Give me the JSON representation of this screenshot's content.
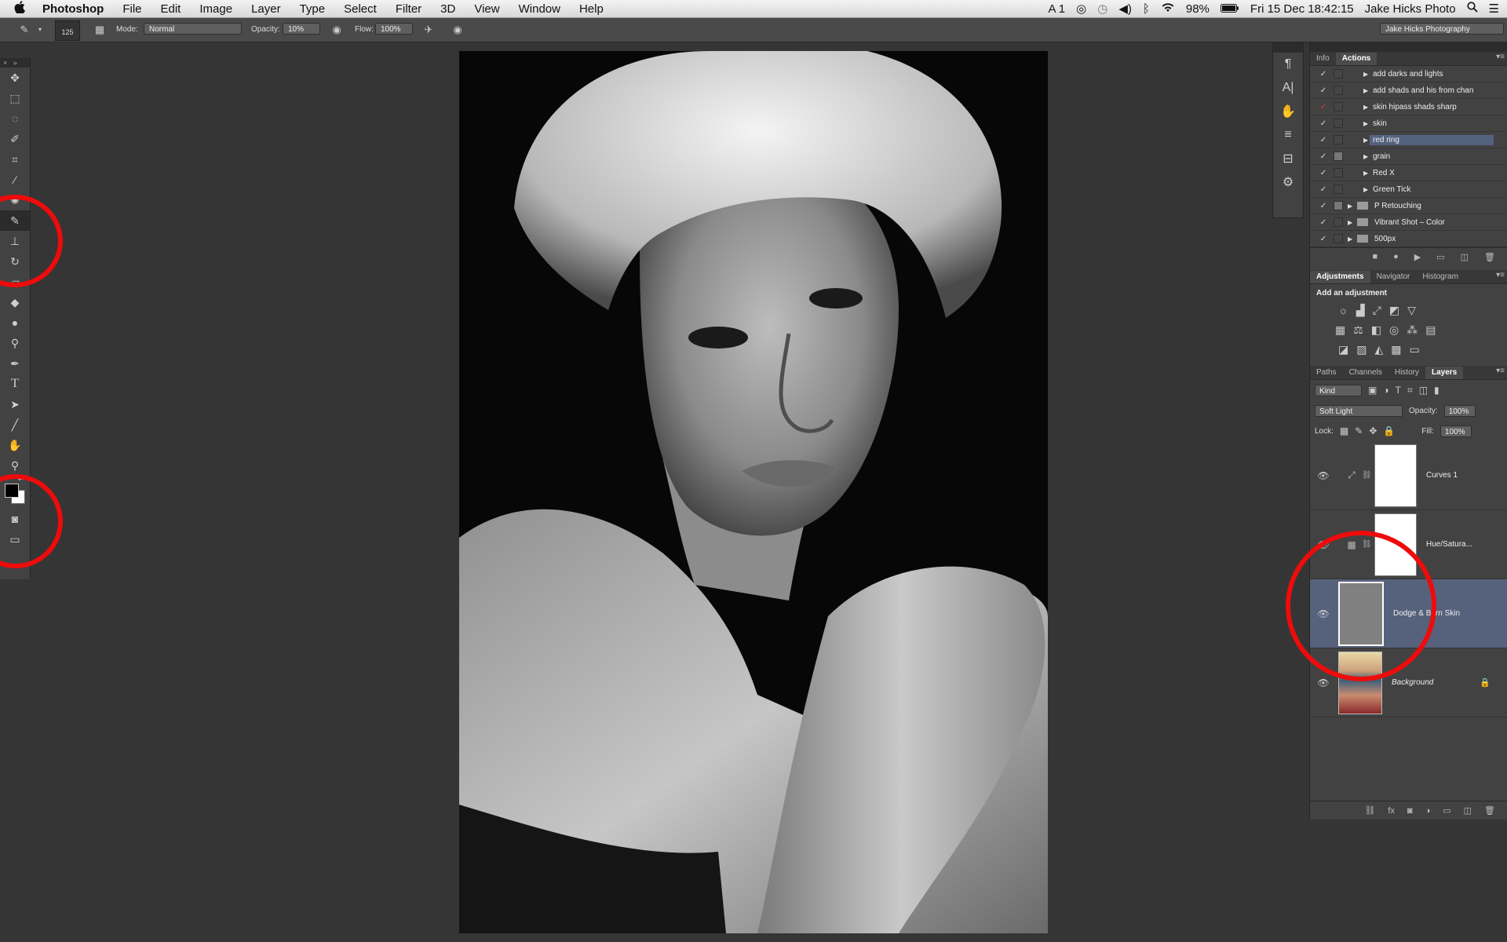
{
  "menubar": {
    "app_name": "Photoshop",
    "items": [
      "File",
      "Edit",
      "Image",
      "Layer",
      "Type",
      "Select",
      "Filter",
      "3D",
      "View",
      "Window",
      "Help"
    ],
    "status": {
      "input": "A 1",
      "battery": "98%",
      "clock": "Fri 15 Dec  18:42:15",
      "user": "Jake Hicks Photo"
    }
  },
  "options_bar": {
    "brush_size": "125",
    "mode_label": "Mode:",
    "mode_value": "Normal",
    "opacity_label": "Opacity:",
    "opacity_value": "10%",
    "flow_label": "Flow:",
    "flow_value": "100%",
    "workspace": "Jake Hicks Photography"
  },
  "actions_panel": {
    "tabs": [
      "Info",
      "Actions"
    ],
    "active_tab": "Actions",
    "rows": [
      {
        "name": "add darks and lights",
        "check": "✓",
        "folder": false,
        "selected": false
      },
      {
        "name": "add shads and his from chan",
        "check": "✓",
        "folder": false,
        "selected": false
      },
      {
        "name": "skin hipass shads sharp",
        "check": "✓",
        "folder": false,
        "selected": false,
        "red_check": true
      },
      {
        "name": "skin",
        "check": "✓",
        "folder": false,
        "selected": false
      },
      {
        "name": "red ring",
        "check": "✓",
        "folder": false,
        "selected": true
      },
      {
        "name": "grain",
        "check": "✓",
        "folder": false,
        "selected": false
      },
      {
        "name": "Red X",
        "check": "✓",
        "folder": false,
        "selected": false
      },
      {
        "name": "Green Tick",
        "check": "✓",
        "folder": false,
        "selected": false
      },
      {
        "name": "P Retouching",
        "check": "✓",
        "folder": true,
        "selected": false
      },
      {
        "name": "Vibrant Shot – Color",
        "check": "✓",
        "folder": true,
        "selected": false
      },
      {
        "name": "500px",
        "check": "✓",
        "folder": true,
        "selected": false
      }
    ]
  },
  "adjustments_panel": {
    "tabs": [
      "Adjustments",
      "Navigator",
      "Histogram"
    ],
    "active_tab": "Adjustments",
    "title": "Add an adjustment"
  },
  "layers_panel": {
    "tabs": [
      "Paths",
      "Channels",
      "History",
      "Layers"
    ],
    "active_tab": "Layers",
    "filter_kind": "Kind",
    "blend_mode": "Soft Light",
    "opacity_label": "Opacity:",
    "opacity_value": "100%",
    "lock_label": "Lock:",
    "fill_label": "Fill:",
    "fill_value": "100%",
    "layers": [
      {
        "name": "Curves 1"
      },
      {
        "name": "Hue/Satura..."
      },
      {
        "name": "Dodge & Burn Skin"
      },
      {
        "name": "Background"
      }
    ]
  },
  "colors": {
    "accent_selected": "#56617c",
    "annotation": "#ee0b0b"
  }
}
